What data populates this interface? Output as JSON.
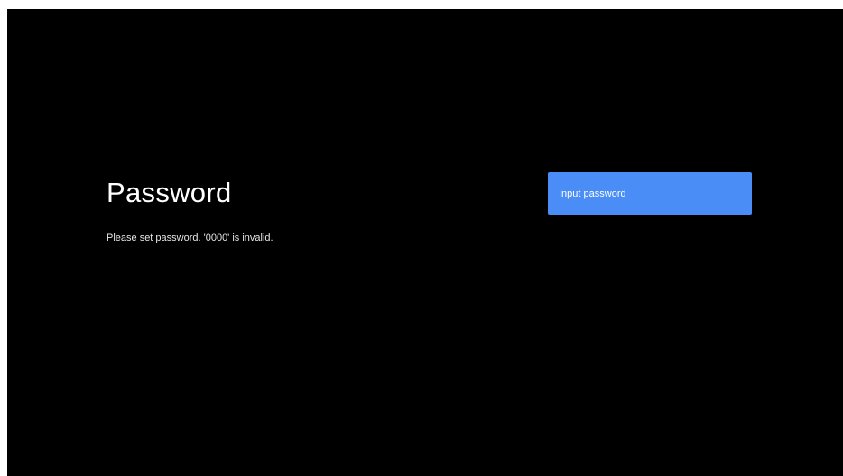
{
  "screen": {
    "title": "Password",
    "subtitle": "Please set password. '0000' is invalid."
  },
  "password_field": {
    "placeholder": "Input password",
    "focused": true
  },
  "colors": {
    "background": "#000000",
    "text": "#ffffff",
    "accent": "#4a8df6"
  }
}
